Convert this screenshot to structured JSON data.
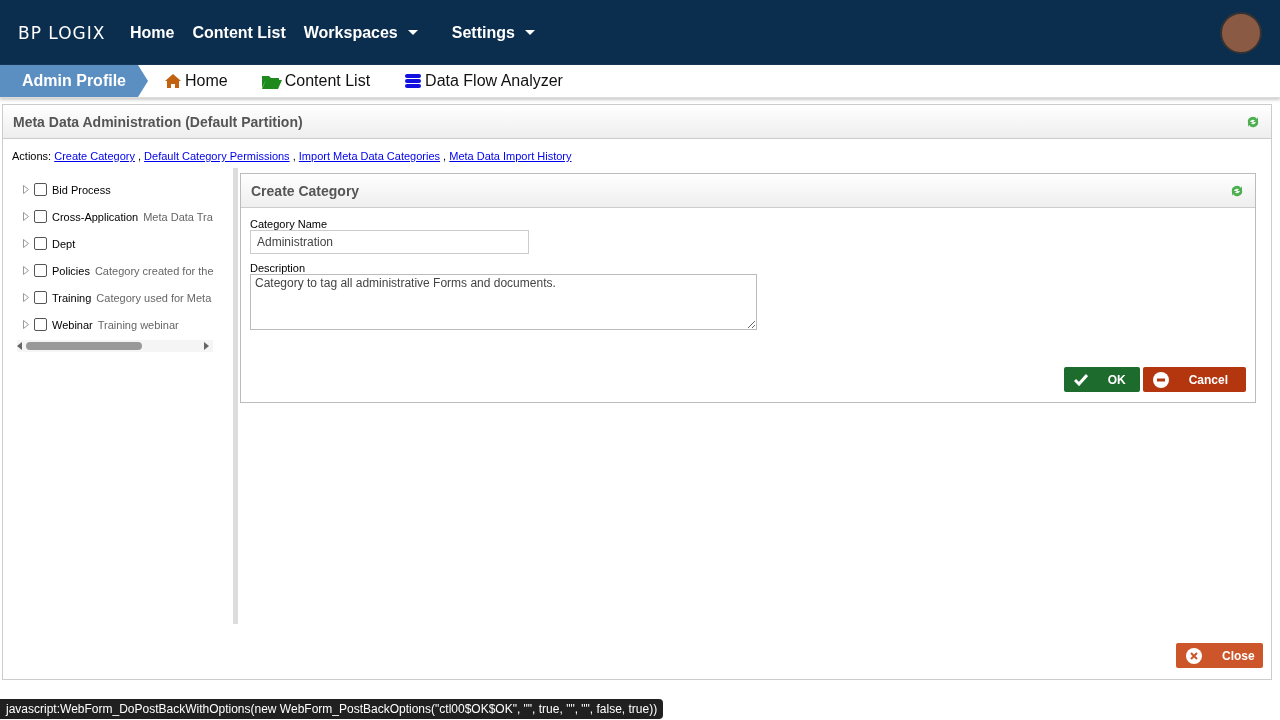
{
  "logo": "BP LOGIX",
  "nav": [
    {
      "label": "Home",
      "dropdown": false
    },
    {
      "label": "Content List",
      "dropdown": false
    },
    {
      "label": "Workspaces",
      "dropdown": true
    },
    {
      "label": "Settings",
      "dropdown": true
    }
  ],
  "breadcrumb": {
    "current": "Admin Profile",
    "links": [
      {
        "kind": "home",
        "label": "Home"
      },
      {
        "kind": "folder",
        "label": "Content List"
      },
      {
        "kind": "database",
        "label": "Data Flow Analyzer"
      }
    ]
  },
  "panel": {
    "title": "Meta Data Administration (Default Partition)",
    "actions_label": "Actions:",
    "separator": ",",
    "actions": [
      "Create Category",
      "Default Category Permissions",
      "Import Meta Data Categories",
      "Meta Data Import History"
    ]
  },
  "tree": [
    {
      "name": "Bid Process",
      "checked": false
    },
    {
      "name": "Cross-Application",
      "description": "Meta Data Tra",
      "checked": false
    },
    {
      "name": "Dept",
      "checked": false
    },
    {
      "name": "Policies",
      "description": "Category created for the",
      "checked": false
    },
    {
      "name": "Training",
      "description": "Category used for Meta",
      "checked": false
    },
    {
      "name": "Webinar",
      "description": "Training webinar",
      "checked": false
    }
  ],
  "form": {
    "title": "Create Category",
    "fields": [
      {
        "kind": "input",
        "label": "Category Name",
        "value": "Administration"
      },
      {
        "kind": "textarea",
        "label": "Description",
        "value": "Category to tag all administrative Forms and documents."
      }
    ],
    "ok": "OK",
    "cancel": "Cancel"
  },
  "close": "Close",
  "status_bar": "javascript:WebForm_DoPostBackWithOptions(new WebForm_PostBackOptions(\"ctl00$OK$OK\", \"\", true, \"\", \"\", false, true))"
}
